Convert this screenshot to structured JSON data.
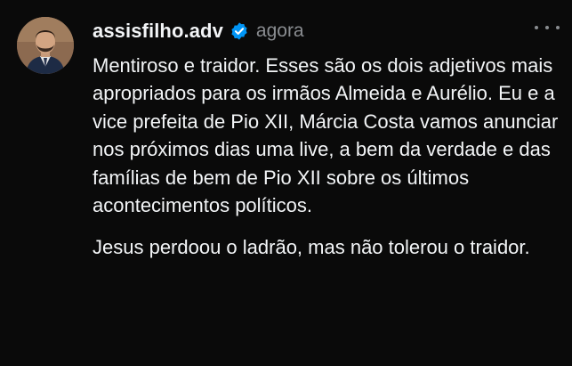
{
  "post": {
    "username": "assisfilho.adv",
    "verified": true,
    "timestamp": "agora",
    "paragraphs": [
      "Mentiroso e traidor. Esses são os dois adjetivos mais apropriados para os irmãos Almeida e Aurélio. Eu e a vice prefeita de Pio XII, Márcia Costa vamos anunciar nos próximos dias uma live, a bem da verdade e das famílias de bem de Pio XII sobre os últimos acontecimentos políticos.",
      "Jesus perdoou o ladrão, mas não tolerou o traidor."
    ]
  },
  "icons": {
    "avatar": "profile-photo",
    "verified": "verified-badge-icon",
    "more": "more-options-icon"
  },
  "colors": {
    "background": "#0a0a0a",
    "text": "#f3f5f7",
    "muted": "#8a8d91",
    "verified": "#0095f6"
  }
}
